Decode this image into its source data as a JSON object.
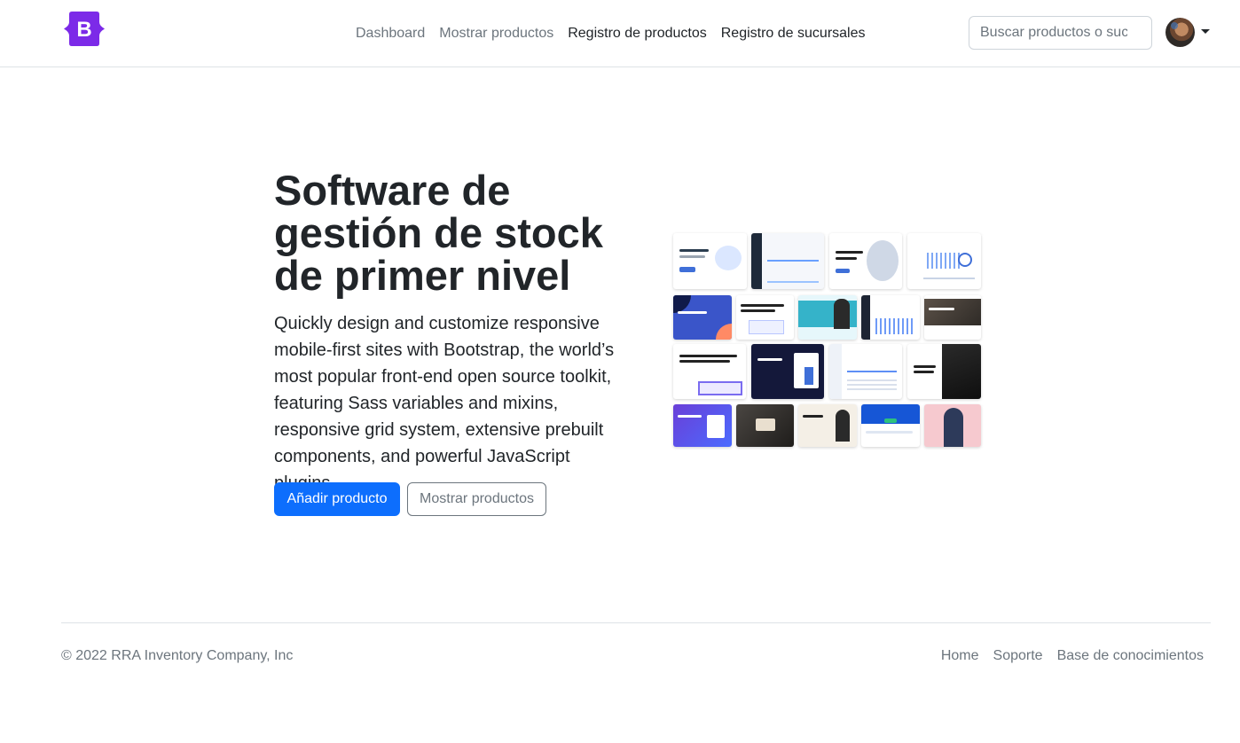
{
  "brand": {
    "logo_letter": "B",
    "logo_color": "#7c2ae8"
  },
  "nav": {
    "items": [
      {
        "label": "Dashboard"
      },
      {
        "label": "Mostrar productos"
      },
      {
        "label": "Registro de productos"
      },
      {
        "label": "Registro de sucursales"
      }
    ]
  },
  "search": {
    "placeholder": "Buscar productos o sucursales..."
  },
  "user_menu": {
    "avatar_icon": "user-avatar",
    "dropdown_icon": "caret-down-icon"
  },
  "hero": {
    "title": "Software de gestión de stock de primer nivel",
    "lead": "Quickly design and customize responsive mobile-first sites with Bootstrap, the world’s most popular front-end open source toolkit, featuring Sass variables and mixins, responsive grid system, extensive prebuilt components, and powerful JavaScript plugins.",
    "primary_button": "Añadir producto",
    "secondary_button": "Mostrar productos",
    "image_label": "bootstrap-themes-collage",
    "accent_color": "#0d6efd"
  },
  "footer": {
    "copyright": "© 2022 RRA Inventory Company, Inc",
    "links": [
      {
        "label": "Home"
      },
      {
        "label": "Soporte"
      },
      {
        "label": "Base de conocimientos"
      }
    ]
  }
}
